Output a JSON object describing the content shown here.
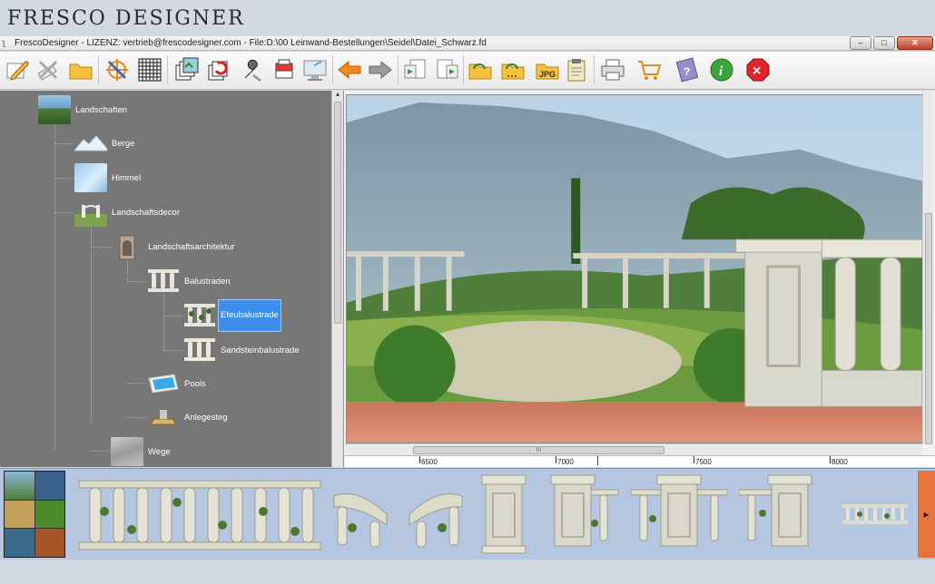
{
  "brand": {
    "name": "FRESCO DESIGNER"
  },
  "window": {
    "title": "FrescoDesigner - LIZENZ: vertrieb@frescodesigner.com - File:D:\\00 Leinwand-Bestellungen\\Seidel\\Datei_Schwarz.fdd - FileOwner:",
    "minimize": "–",
    "maximize": "□",
    "close": "✕"
  },
  "toolbar": {
    "buttons": [
      {
        "id": "edit",
        "icon": "pencil-paper-icon"
      },
      {
        "id": "erase",
        "icon": "brush-cross-icon"
      },
      {
        "id": "open",
        "icon": "folder-icon"
      },
      {
        "id": "no-target",
        "icon": "crosshair-cancel-icon"
      },
      {
        "id": "grid",
        "icon": "grid-icon"
      },
      {
        "id": "layers",
        "icon": "layers-icon"
      },
      {
        "id": "layers-refresh",
        "icon": "layers-refresh-icon"
      },
      {
        "id": "tools",
        "icon": "wrench-icon"
      },
      {
        "id": "stack",
        "icon": "stack-icon"
      },
      {
        "id": "monitor",
        "icon": "monitor-icon"
      },
      {
        "id": "back",
        "icon": "arrow-left-icon"
      },
      {
        "id": "forward",
        "icon": "arrow-right-icon"
      },
      {
        "id": "import",
        "icon": "import-icon"
      },
      {
        "id": "export",
        "icon": "export-icon"
      },
      {
        "id": "folder-open",
        "icon": "folder-open-icon"
      },
      {
        "id": "folder-dots",
        "icon": "folder-dots-icon"
      },
      {
        "id": "jpg",
        "icon": "jpg-folder-icon",
        "label": "JPG"
      },
      {
        "id": "clipboard",
        "icon": "clipboard-icon"
      },
      {
        "id": "print",
        "icon": "printer-icon"
      },
      {
        "id": "cart",
        "icon": "cart-icon"
      },
      {
        "id": "help",
        "icon": "help-book-icon",
        "label": "?"
      },
      {
        "id": "info",
        "icon": "info-icon",
        "label": "i"
      },
      {
        "id": "exit",
        "icon": "close-icon",
        "label": "×"
      }
    ]
  },
  "tree": {
    "nodes": [
      {
        "label": "Landschaften",
        "icon": "landscape-icon"
      },
      {
        "label": "Berge",
        "icon": "mountains-icon"
      },
      {
        "label": "Himmel",
        "icon": "sky-icon"
      },
      {
        "label": "Landschaftsdecor",
        "icon": "landscape-decor-icon"
      },
      {
        "label": "Landschaftsarchitektur",
        "icon": "architecture-icon"
      },
      {
        "label": "Balustraden",
        "icon": "balustrade-icon"
      },
      {
        "label": "Efeubalustrade",
        "icon": "ivy-balustrade-icon",
        "selected": true
      },
      {
        "label": "Sandsteinbalustrade",
        "icon": "sandstone-balustrade-icon"
      },
      {
        "label": "Pools",
        "icon": "pool-icon"
      },
      {
        "label": "Anlegesteg",
        "icon": "jetty-icon"
      },
      {
        "label": "Wege",
        "icon": "path-icon"
      }
    ]
  },
  "ruler": {
    "labels": [
      "6500",
      "7000",
      "7500",
      "8000"
    ]
  },
  "canvas": {
    "hscroll_grip": "III",
    "vscroll_grip": "≡"
  },
  "strip": {
    "next": "▸",
    "items": [
      {
        "name": "ivy-balustrade-long"
      },
      {
        "name": "ivy-balustrade-curve-left"
      },
      {
        "name": "ivy-balustrade-curve-right"
      },
      {
        "name": "pillar"
      },
      {
        "name": "pillar-with-rail-right"
      },
      {
        "name": "pillar-with-rails"
      },
      {
        "name": "pillar-with-rail-left"
      },
      {
        "name": "ivy-balustrade-small"
      }
    ]
  },
  "colors": {
    "tree_bg": "#777777",
    "selection": "#3d8ee8",
    "strip_bg": "#b5c6e0",
    "strip_next": "#e8733b"
  }
}
